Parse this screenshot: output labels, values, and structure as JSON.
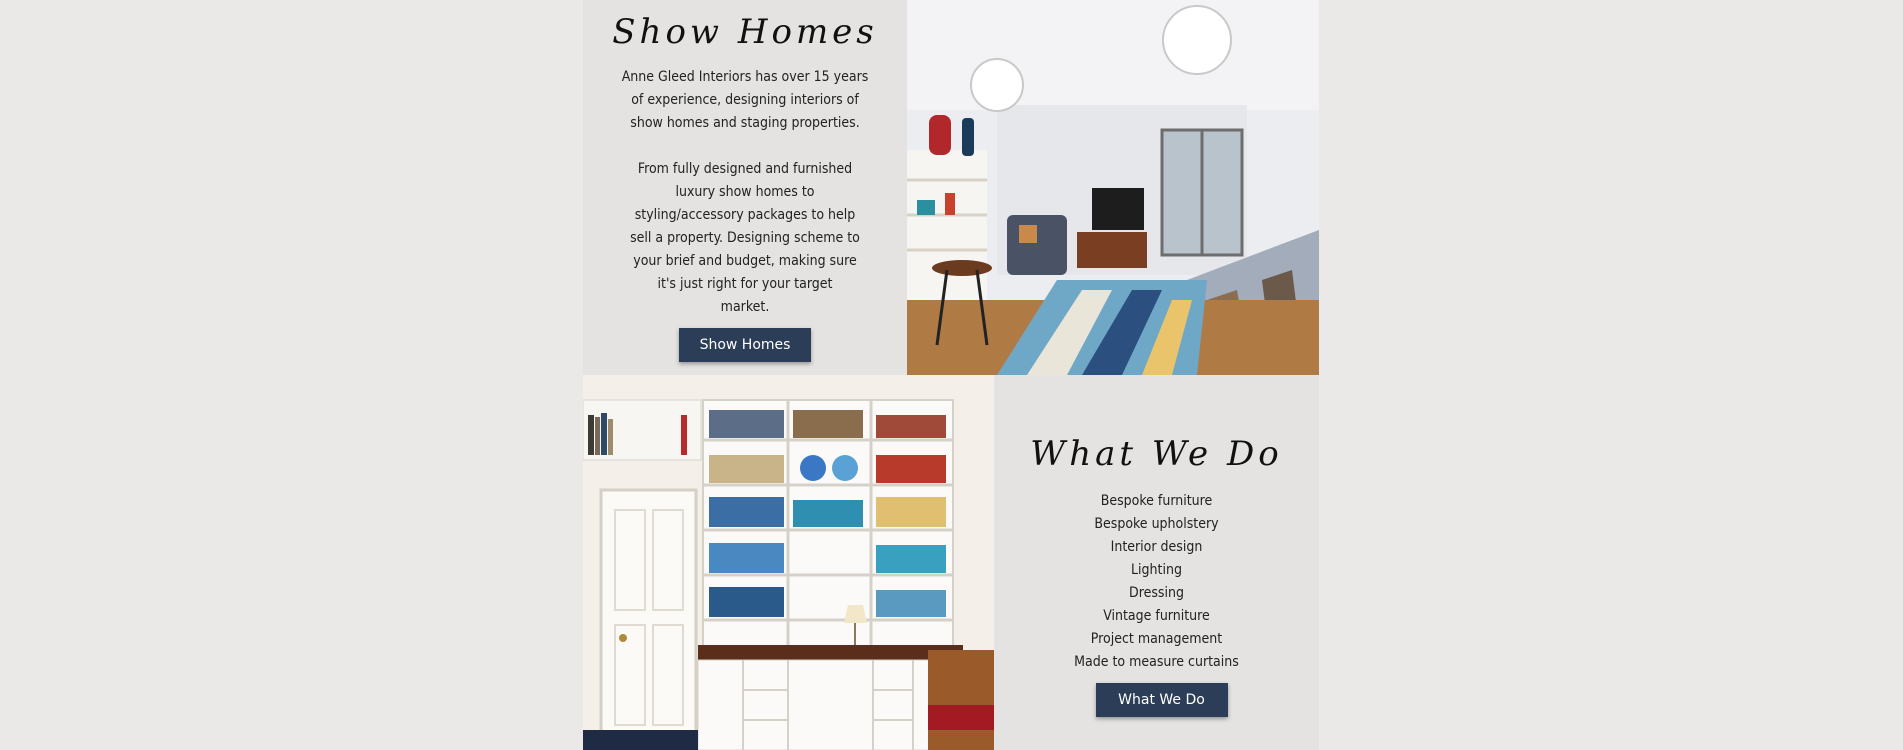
{
  "show_homes": {
    "title": "Show Homes",
    "para1_lines": [
      "Anne Gleed Interiors has over 15 years",
      "of experience, designing interiors of",
      "show homes and staging properties."
    ],
    "para2_lines": [
      "From fully designed and furnished",
      "luxury show homes to",
      "styling/accessory packages to help",
      "sell a property. Designing scheme to",
      "your brief and budget, making sure",
      "it's just right for your target",
      "market."
    ],
    "button_label": "Show Homes"
  },
  "what_we_do": {
    "title": "What We Do",
    "services": [
      "Bespoke furniture",
      "Bespoke upholstery",
      "Interior design",
      "Lighting",
      "Dressing",
      "Vintage furniture",
      "Project management",
      "Made to measure curtains"
    ],
    "button_label": "What We Do"
  },
  "colors": {
    "page_bg": "#ebe9e7",
    "panel_bg": "#e4e3e1",
    "button_bg": "#2c3e57",
    "button_text": "#ffffff"
  }
}
